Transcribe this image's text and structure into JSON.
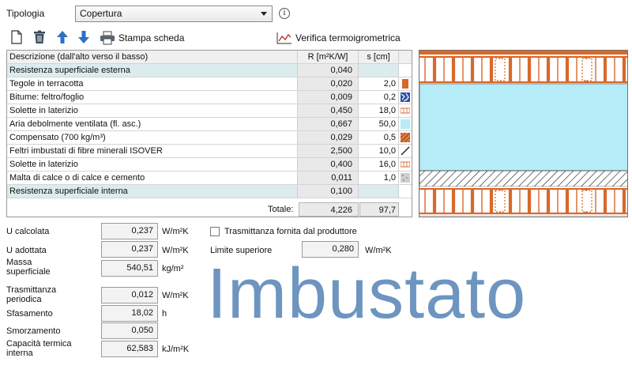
{
  "header": {
    "typology_label": "Tipologia",
    "typology_value": "Copertura",
    "info_glyph": "i"
  },
  "toolbar": {
    "print_label": "Stampa scheda",
    "verify_label": "Verifica termoigrometrica"
  },
  "table": {
    "columns": [
      "Descrizione (dall'alto verso il basso)",
      "R [m²K/W]",
      "s [cm]"
    ],
    "rows": [
      {
        "desc": "Resistenza superficiale esterna",
        "r": "0,040",
        "s": "",
        "type": "res"
      },
      {
        "desc": "Tegole in terracotta",
        "r": "0,020",
        "s": "2,0",
        "material": "terracotta"
      },
      {
        "desc": "Bitume: feltro/foglio",
        "r": "0,009",
        "s": "0,2",
        "material": "bitumen"
      },
      {
        "desc": "Solette in laterizio",
        "r": "0,450",
        "s": "18,0",
        "material": "brick"
      },
      {
        "desc": "Aria debolmente ventilata (fl. asc.)",
        "r": "0,667",
        "s": "50,0",
        "material": "air"
      },
      {
        "desc": "Compensato (700 kg/m³)",
        "r": "0,029",
        "s": "0,5",
        "material": "plywood"
      },
      {
        "desc": "Feltri imbustati di fibre minerali ISOVER",
        "r": "2,500",
        "s": "10,0",
        "material": "felt"
      },
      {
        "desc": "Solette in laterizio",
        "r": "0,400",
        "s": "16,0",
        "material": "brick"
      },
      {
        "desc": "Malta di calce o di calce e cemento",
        "r": "0,011",
        "s": "1,0",
        "material": "mortar"
      },
      {
        "desc": "Resistenza superficiale interna",
        "r": "0,100",
        "s": "",
        "type": "res"
      }
    ],
    "total_label": "Totale:",
    "total_r": "4,226",
    "total_s": "97,7"
  },
  "results": {
    "u_calc_label": "U calcolata",
    "u_calc_value": "0,237",
    "u_calc_unit": "W/m²K",
    "u_adopted_label": "U adottata",
    "u_adopted_value": "0,237",
    "u_adopted_unit": "W/m²K",
    "mass_label_1": "Massa",
    "mass_label_2": "superficiale",
    "mass_value": "540,51",
    "mass_unit": "kg/m²",
    "periodic_label_1": "Trasmittanza",
    "periodic_label_2": "periodica",
    "periodic_value": "0,012",
    "periodic_unit": "W/m²K",
    "shift_label": "Sfasamento",
    "shift_value": "18,02",
    "shift_unit": "h",
    "damping_label": "Smorzamento",
    "damping_value": "0,050",
    "capacity_label_1": "Capacità termica",
    "capacity_label_2": "interna",
    "capacity_value": "62,583",
    "capacity_unit": "kJ/m²K",
    "producer_checkbox_label": "Trasmittanza fornita dal produttore",
    "upper_limit_label": "Limite superiore",
    "upper_limit_value": "0,280",
    "upper_limit_unit": "W/m²K"
  },
  "watermark": "Imbustato",
  "colors": {
    "terracotta": "#d9682a",
    "air": "#b5ecf8",
    "resistance_row": "#dcecee",
    "watermark": "#6d95c0",
    "bitumen": "#2a4fa8",
    "plywood": "#c25a1e"
  },
  "icons": [
    "new-document-icon",
    "delete-icon",
    "arrow-up-icon",
    "arrow-down-icon",
    "printer-icon",
    "chart-line-icon",
    "info-icon",
    "dropdown-caret-icon"
  ]
}
